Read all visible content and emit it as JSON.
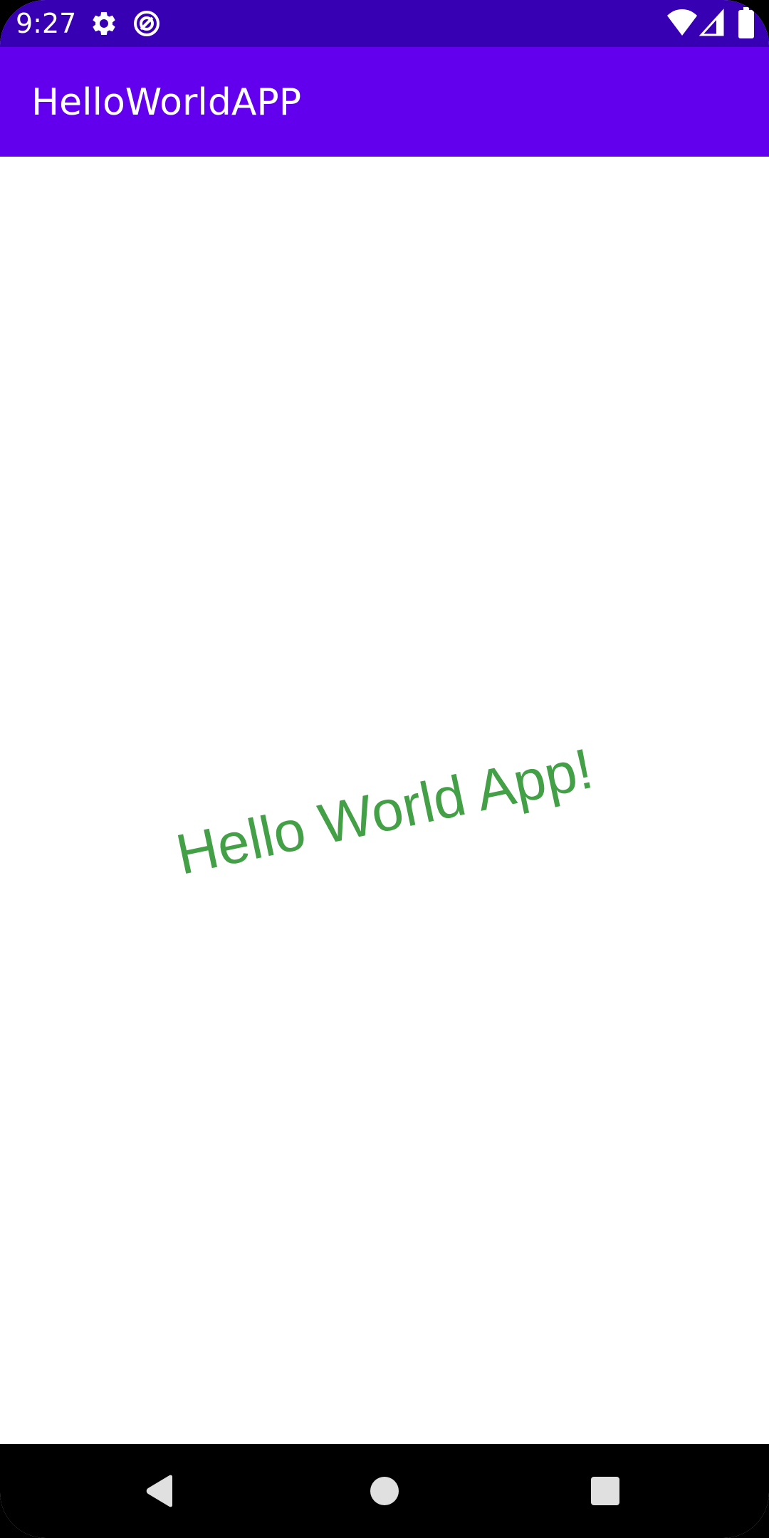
{
  "status_bar": {
    "time": "9:27",
    "left_icons": [
      "gear-icon",
      "data-saver-icon"
    ],
    "right_icons": [
      "wifi-icon",
      "signal-icon",
      "battery-icon"
    ],
    "color": "#3700b3"
  },
  "app_bar": {
    "title": "HelloWorldAPP",
    "color": "#6200ee"
  },
  "content": {
    "message": "Hello World App!",
    "message_color": "#43a047"
  },
  "nav_bar": {
    "buttons": [
      "back-icon",
      "home-icon",
      "recents-icon"
    ]
  }
}
